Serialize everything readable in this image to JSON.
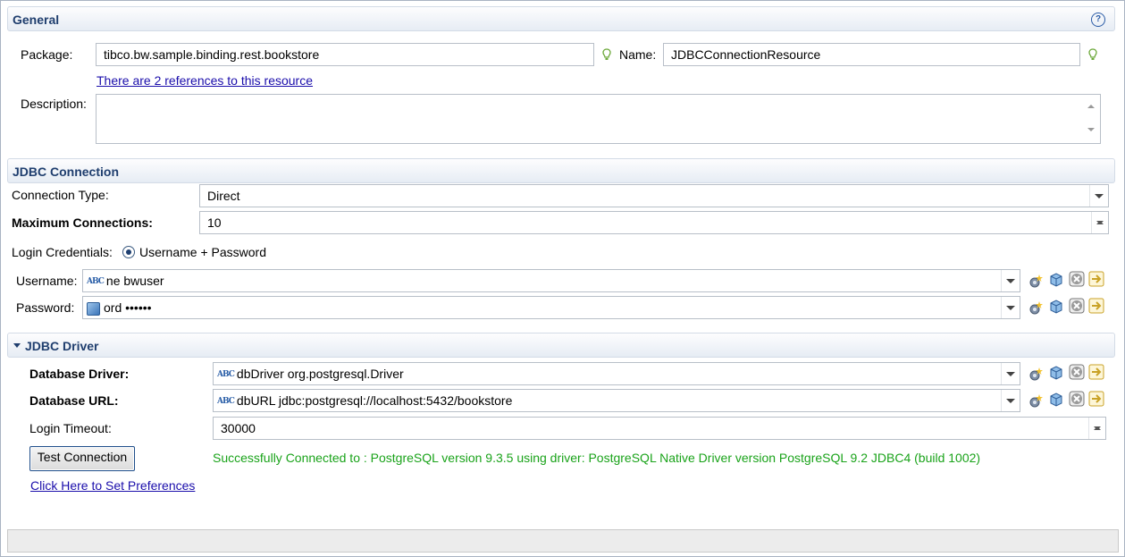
{
  "general": {
    "title": "General",
    "package_label": "Package:",
    "package_value": "tibco.bw.sample.binding.rest.bookstore",
    "name_label": "Name:",
    "name_value": "JDBCConnectionResource",
    "references_link": "There are 2 references to this resource",
    "description_label": "Description:",
    "description_value": ""
  },
  "jdbc_connection": {
    "title": "JDBC Connection",
    "connection_type_label": "Connection Type:",
    "connection_type_value": "Direct",
    "max_connections_label": "Maximum Connections:",
    "max_connections_value": "10",
    "login_credentials_label": "Login Credentials:",
    "login_credentials_option": "Username + Password",
    "username_label": "Username:",
    "username_value": "ne bwuser",
    "password_label": "Password:",
    "password_value": "ord ••••••"
  },
  "jdbc_driver": {
    "title": "JDBC Driver",
    "db_driver_label": "Database Driver:",
    "db_driver_value": "dbDriver org.postgresql.Driver",
    "db_url_label": "Database URL:",
    "db_url_value": "dbURL jdbc:postgresql://localhost:5432/bookstore",
    "login_timeout_label": "Login Timeout:",
    "login_timeout_value": "30000",
    "test_connection_button": "Test Connection",
    "success_message": "Successfully Connected to : PostgreSQL version 9.3.5 using driver: PostgreSQL Native Driver version PostgreSQL 9.2 JDBC4 (build 1002)",
    "preferences_link": "Click Here to Set Preferences"
  },
  "icon_text": {
    "abc": "ABC"
  },
  "colors": {
    "section_title": "#1f3e6e",
    "success": "#1aa31a",
    "link": "#1a0dab"
  }
}
